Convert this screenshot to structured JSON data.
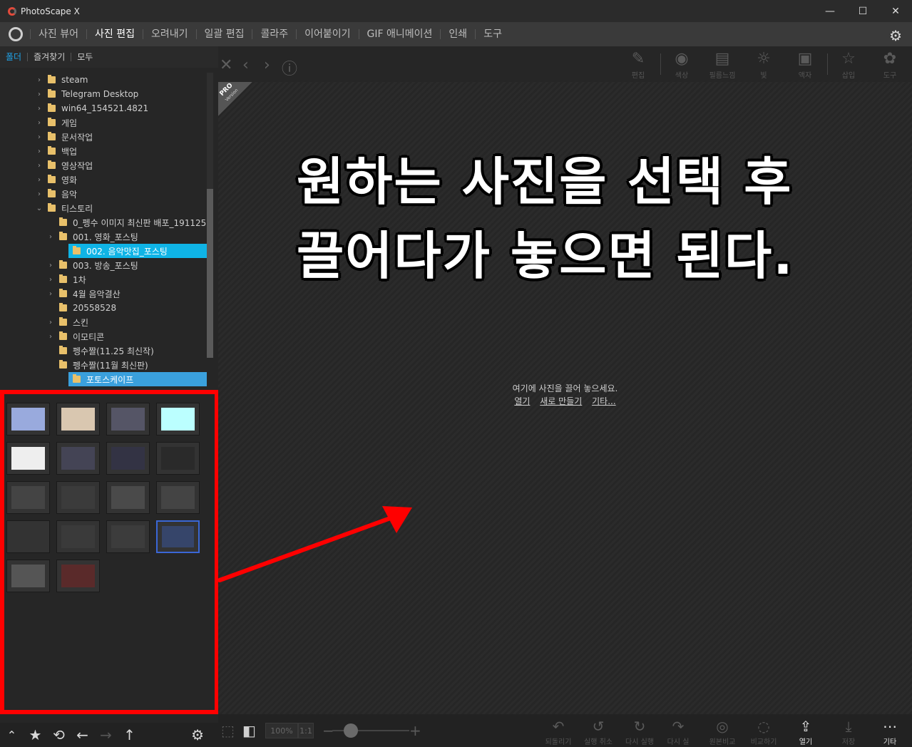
{
  "window": {
    "title": "PhotoScape X",
    "minimize": "—",
    "maximize": "☐",
    "close": "✕"
  },
  "menu": {
    "items": [
      "사진 뷰어",
      "사진 편집",
      "오려내기",
      "일괄 편집",
      "콜라주",
      "이어붙이기",
      "GIF 애니메이션",
      "인쇄",
      "도구"
    ],
    "active_index": 1
  },
  "side_tabs": [
    "폴더",
    "즐겨찾기",
    "모두"
  ],
  "folder_tree": [
    {
      "label": "steam",
      "depth": 0,
      "chevron": "›"
    },
    {
      "label": "Telegram Desktop",
      "depth": 0,
      "chevron": "›"
    },
    {
      "label": "win64_154521.4821",
      "depth": 0,
      "chevron": "›"
    },
    {
      "label": "게임",
      "depth": 0,
      "chevron": "›"
    },
    {
      "label": "문서작업",
      "depth": 0,
      "chevron": "›"
    },
    {
      "label": "백업",
      "depth": 0,
      "chevron": "›"
    },
    {
      "label": "영상작업",
      "depth": 0,
      "chevron": "›"
    },
    {
      "label": "영화",
      "depth": 0,
      "chevron": "›"
    },
    {
      "label": "음악",
      "depth": 0,
      "chevron": "›"
    },
    {
      "label": "티스토리",
      "depth": 0,
      "chevron": "⌄"
    },
    {
      "label": "0_펭수 이미지 최신판 배포_191125",
      "depth": 1,
      "chevron": ""
    },
    {
      "label": "001. 영화_포스팅",
      "depth": 1,
      "chevron": "›"
    },
    {
      "label": "002. 음악맛집_포스팅",
      "depth": 1,
      "chevron": "›",
      "selected": true
    },
    {
      "label": "003. 방송_포스팅",
      "depth": 1,
      "chevron": "›"
    },
    {
      "label": "1차",
      "depth": 1,
      "chevron": "›"
    },
    {
      "label": "4월 음악결산",
      "depth": 1,
      "chevron": "›"
    },
    {
      "label": "20558528",
      "depth": 1,
      "chevron": ""
    },
    {
      "label": "스킨",
      "depth": 1,
      "chevron": "›"
    },
    {
      "label": "이모티콘",
      "depth": 1,
      "chevron": "›"
    },
    {
      "label": "펭수짤(11.25 최신작)",
      "depth": 1,
      "chevron": ""
    },
    {
      "label": "펭수짤(11월 최신판)",
      "depth": 1,
      "chevron": ""
    },
    {
      "label": "포토스케이프",
      "depth": 1,
      "chevron": "",
      "current": true
    }
  ],
  "thumbnails": {
    "count": 18,
    "selected_index": 15
  },
  "bottom_left": {
    "up": "⌃",
    "star": "★",
    "refresh": "⟲",
    "back": "←",
    "forward": "→",
    "parent": "↑",
    "gear": "⚙"
  },
  "editor_nav": {
    "close": "✕",
    "prev": "‹",
    "next": "›",
    "info": "ⓘ"
  },
  "tools": [
    "편집",
    "색상",
    "필름느낌",
    "빛",
    "액자",
    "삽입",
    "도구"
  ],
  "pro_badge": {
    "title": "PRO",
    "sub": "Version"
  },
  "overlay_text": [
    "원하는 사진을 선택 후",
    "끌어다가 놓으면 된다."
  ],
  "drop_zone": {
    "message": "여기에 사진을 끌어 놓으세요.",
    "links": [
      "열기",
      "새로 만들기",
      "기타..."
    ]
  },
  "bottom_right": {
    "zoom": "100%",
    "ratio": "1:1",
    "actions": [
      "되돌리기",
      "실행 취소",
      "다시 실행",
      "다시 실",
      "원본비교",
      "비교하기",
      "열기",
      "저장",
      "기타"
    ]
  },
  "colors": {
    "highlight_box": "#ff0000",
    "selection": "#0fb4e6",
    "accent": "#1fa3e8"
  }
}
